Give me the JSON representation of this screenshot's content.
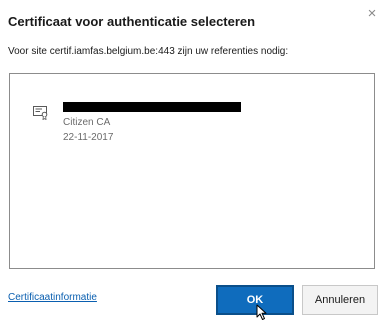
{
  "dialog": {
    "title": "Certificaat voor authenticatie selecteren",
    "close_glyph": "×",
    "subtitle": "Voor site certif.iamfas.belgium.be:443 zijn uw referenties nodig:"
  },
  "certificates": [
    {
      "name": "[redacted]",
      "issuer": "Citizen CA",
      "date": "22-11-2017",
      "icon": "certificate-icon"
    }
  ],
  "footer": {
    "info_link": "Certificaatinformatie",
    "ok_label": "OK",
    "cancel_label": "Annuleren"
  },
  "colors": {
    "accent": "#0f6cbd",
    "link": "#0a5fb0"
  }
}
